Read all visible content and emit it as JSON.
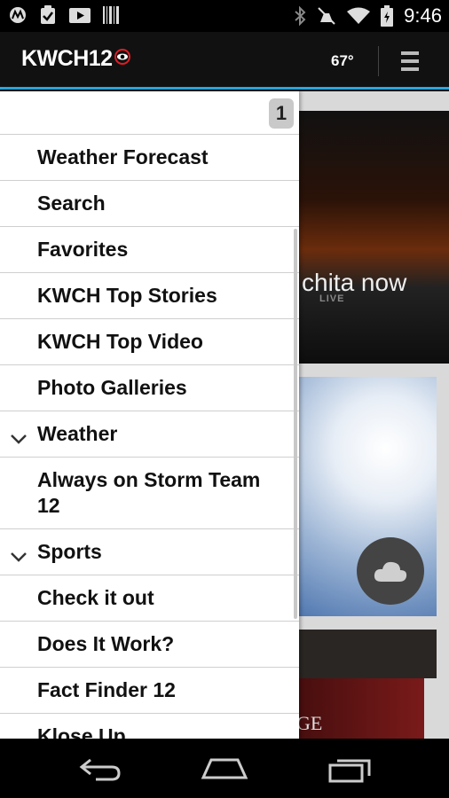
{
  "status_bar": {
    "time": "9:46",
    "left_icons": [
      "motorola-icon",
      "clipboard-icon",
      "video-icon",
      "barcode-icon"
    ],
    "right_icons": [
      "bluetooth-icon",
      "mute-icon",
      "wifi-icon",
      "battery-icon"
    ]
  },
  "header": {
    "logo": "KWCH12",
    "temperature": "67°",
    "menu_icon": "hamburger-icon",
    "accent_color": "#2aa7df"
  },
  "drawer": {
    "badge": "1",
    "items": [
      {
        "label": "Weather Forecast",
        "expandable": false
      },
      {
        "label": "Search",
        "expandable": false
      },
      {
        "label": "Favorites",
        "expandable": false
      },
      {
        "label": "KWCH Top Stories",
        "expandable": false
      },
      {
        "label": "KWCH Top Video",
        "expandable": false
      },
      {
        "label": "Photo Galleries",
        "expandable": false
      },
      {
        "label": "Weather",
        "expandable": true
      },
      {
        "label": "Always on Storm Team 12",
        "expandable": false
      },
      {
        "label": "Sports",
        "expandable": true
      },
      {
        "label": "Check it out",
        "expandable": false
      },
      {
        "label": "Does It Work?",
        "expandable": false
      },
      {
        "label": "Fact Finder 12",
        "expandable": false
      },
      {
        "label": "Klose Up",
        "expandable": false
      }
    ]
  },
  "background": {
    "hero_text": "chita now",
    "live_label": "LIVE",
    "bottom_text": "GE",
    "cloud_icon": "cloud-icon"
  },
  "nav_bar": {
    "icons": [
      "back-icon",
      "home-icon",
      "recents-icon"
    ]
  }
}
